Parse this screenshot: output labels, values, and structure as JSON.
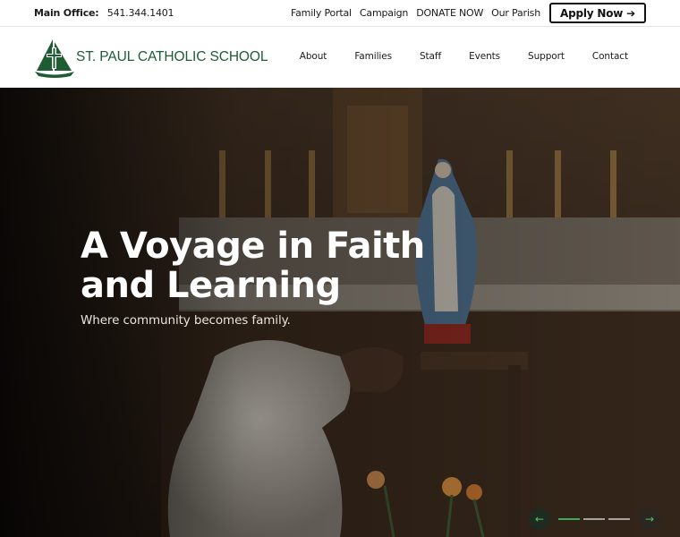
{
  "topbar": {
    "office_label": "Main Office:",
    "office_phone": "541.344.1401",
    "links": [
      "Family Portal",
      "Campaign",
      "DONATE NOW",
      "Our Parish"
    ],
    "apply_label": "Apply Now",
    "apply_icon": "arrow-right-icon"
  },
  "header": {
    "school_name": "ST. PAUL CATHOLIC SCHOOL",
    "logo_icon": "sailboat-cross-logo",
    "brand_color": "#1e5c34",
    "nav": [
      "About",
      "Families",
      "Staff",
      "Events",
      "Support",
      "Contact"
    ]
  },
  "hero": {
    "title": "A Voyage in Faith and Learning",
    "subtitle": "Where community becomes family.",
    "slider": {
      "prev_icon": "arrow-left-icon",
      "next_icon": "arrow-right-icon",
      "slide_count": 3,
      "active_slide": 1,
      "accent_color": "#3daa5a"
    }
  }
}
